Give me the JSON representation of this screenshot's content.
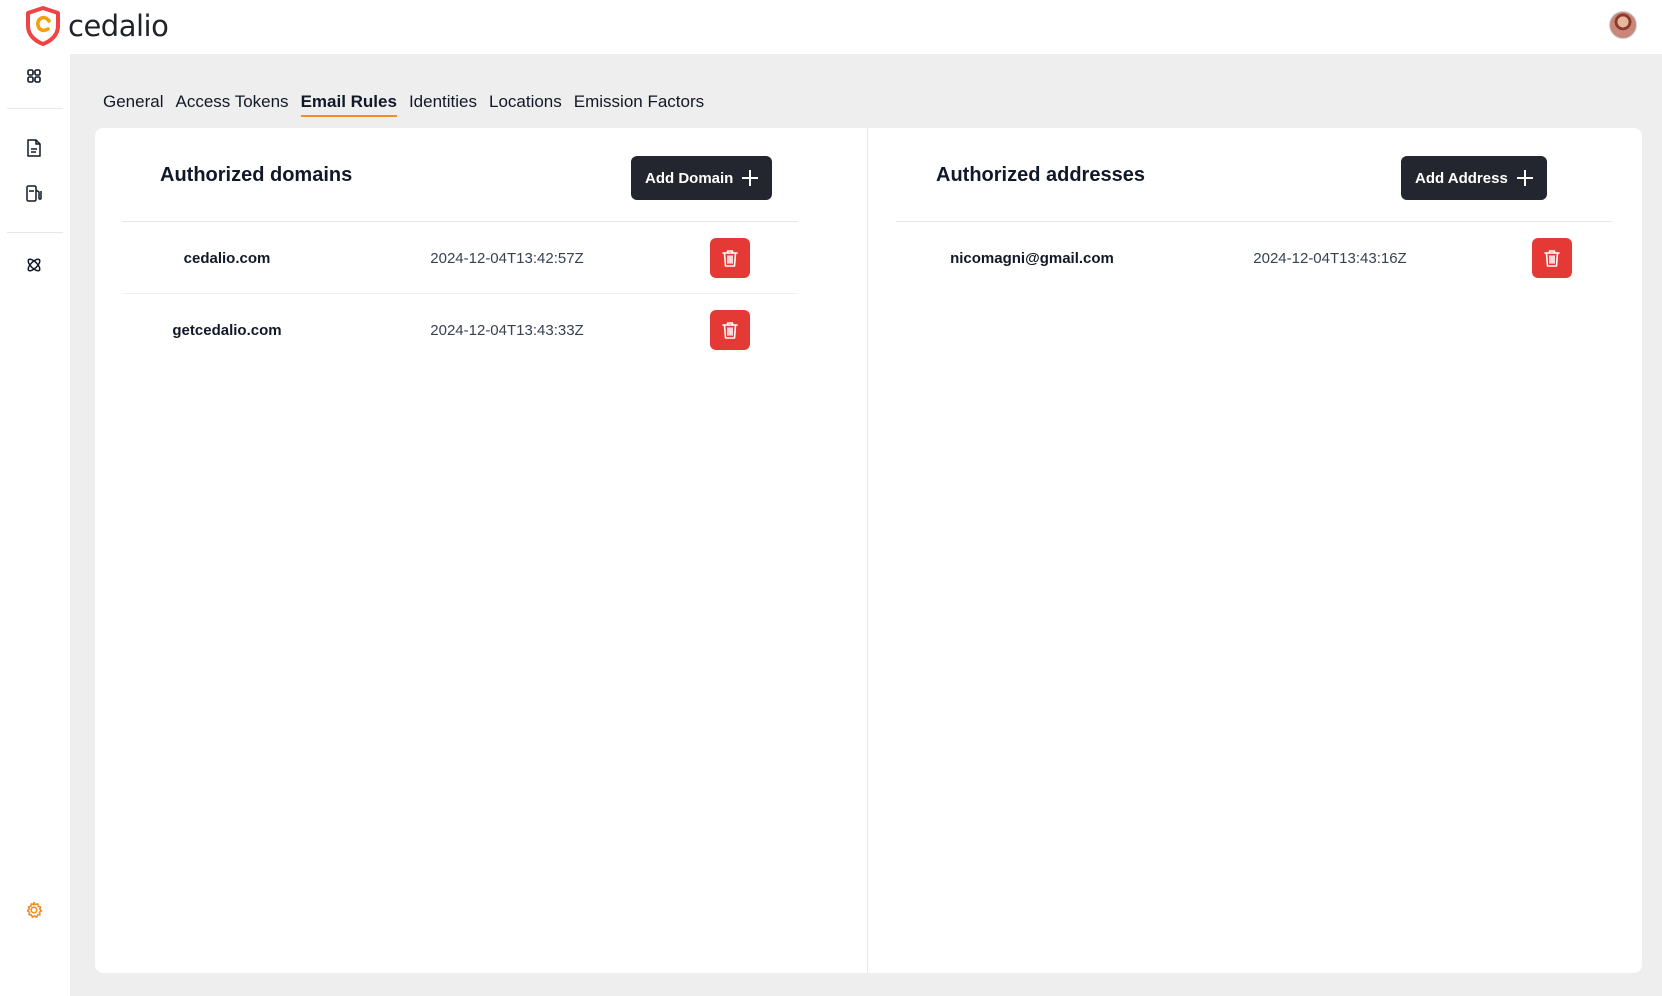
{
  "app": {
    "name": "cedalio",
    "brand_color": "#f28c28",
    "danger_color": "#e53935",
    "dark_button_color": "#23262e"
  },
  "header": {
    "logo_text": "cedalio",
    "avatar_icon": "user-avatar"
  },
  "sidebar": {
    "items": [
      {
        "name": "dashboard",
        "icon": "grid-icon"
      },
      {
        "name": "documents",
        "icon": "document-icon"
      },
      {
        "name": "fuel",
        "icon": "fuel-pump-icon"
      },
      {
        "name": "integrations",
        "icon": "atom-icon"
      },
      {
        "name": "settings",
        "icon": "gear-icon"
      }
    ]
  },
  "tabs": [
    {
      "label": "General",
      "active": false
    },
    {
      "label": "Access Tokens",
      "active": false
    },
    {
      "label": "Email Rules",
      "active": true
    },
    {
      "label": "Identities",
      "active": false
    },
    {
      "label": "Locations",
      "active": false
    },
    {
      "label": "Emission Factors",
      "active": false
    }
  ],
  "domains": {
    "title": "Authorized domains",
    "add_label": "Add Domain",
    "rows": [
      {
        "name": "cedalio.com",
        "date": "2024-12-04T13:42:57Z"
      },
      {
        "name": "getcedalio.com",
        "date": "2024-12-04T13:43:33Z"
      }
    ]
  },
  "addresses": {
    "title": "Authorized addresses",
    "add_label": "Add Address",
    "rows": [
      {
        "name": "nicomagni@gmail.com",
        "date": "2024-12-04T13:43:16Z"
      }
    ]
  }
}
